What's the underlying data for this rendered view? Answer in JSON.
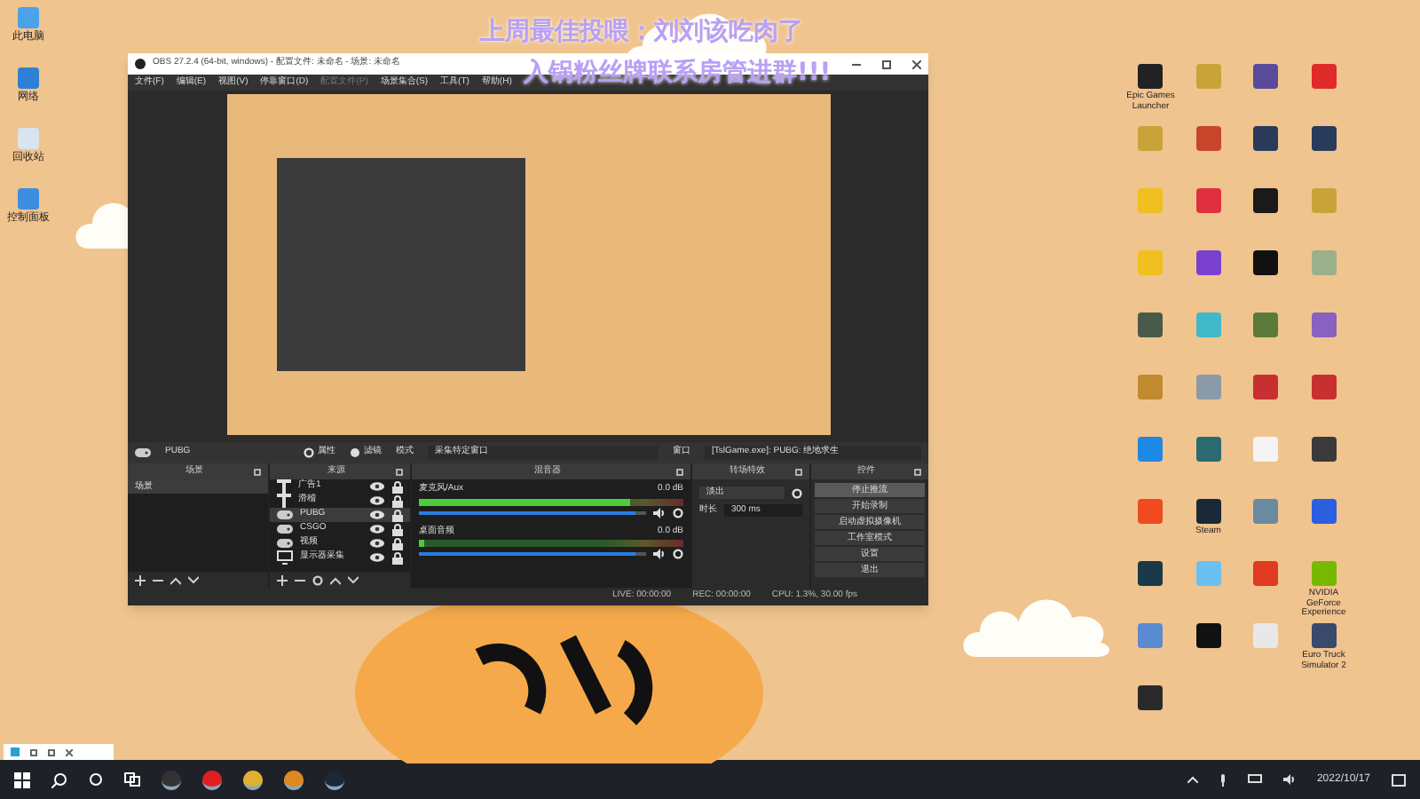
{
  "overlay": {
    "lines": [
      "上周最佳投喂：刘刘该吃肉了",
      "入锅粉丝牌联系房管进群!!!"
    ]
  },
  "left_icons": [
    {
      "label": "此电脑",
      "color": "#4aa3e8"
    },
    {
      "label": "网络",
      "color": "#2f7fd6"
    },
    {
      "label": "回收站",
      "color": "#d8e4ee"
    },
    {
      "label": "控制面板",
      "color": "#3d8ee0"
    }
  ],
  "right_icons": [
    {
      "label": "Epic Games Launcher",
      "color": "#222222"
    },
    {
      "color": "#c9a23a"
    },
    {
      "color": "#5a4a9a"
    },
    {
      "color": "#e02a2a"
    },
    {
      "color": "#c9a23a"
    },
    {
      "color": "#c8452c"
    },
    {
      "color": "#2a3a5a"
    },
    {
      "color": "#2a3a5a"
    },
    {
      "color": "#f0c020"
    },
    {
      "color": "#e03040"
    },
    {
      "color": "#1a1a1a"
    },
    {
      "color": "#c9a23a"
    },
    {
      "color": "#f0c020"
    },
    {
      "color": "#7a40d0"
    },
    {
      "color": "#111111"
    },
    {
      "color": "#9ab08a"
    },
    {
      "color": "#4a5a4a"
    },
    {
      "color": "#40b8c8"
    },
    {
      "color": "#5a7a3a"
    },
    {
      "color": "#8a60c0"
    },
    {
      "color": "#c08a30"
    },
    {
      "color": "#8a9aa8"
    },
    {
      "color": "#c83030"
    },
    {
      "color": "#c83030"
    },
    {
      "color": "#1e88e5"
    },
    {
      "color": "#2a6a70"
    },
    {
      "color": "#f4f4f4"
    },
    {
      "color": "#3a3a3a"
    },
    {
      "color": "#f04a20"
    },
    {
      "label": "Steam",
      "color": "#1b2838"
    },
    {
      "color": "#6a8aa0"
    },
    {
      "color": "#2a60e0"
    },
    {
      "color": "#1a3a4a"
    },
    {
      "color": "#6ac0f0"
    },
    {
      "color": "#e03a20"
    },
    {
      "label": "NVIDIA GeForce Experience",
      "color": "#76b900"
    },
    {
      "color": "#5a8ad0"
    },
    {
      "color": "#111111"
    },
    {
      "color": "#e8e8e8"
    },
    {
      "label": "Euro Truck Simulator 2",
      "color": "#3a4a6a"
    },
    {
      "color": "#2a2a2a"
    }
  ],
  "obs": {
    "title": "OBS 27.2.4 (64-bit, windows) - 配置文件: 未命名 - 场景: 未命名",
    "menu": [
      {
        "label": "文件(F)",
        "disabled": false
      },
      {
        "label": "编辑(E)",
        "disabled": false
      },
      {
        "label": "视图(V)",
        "disabled": false
      },
      {
        "label": "停靠窗口(D)",
        "disabled": false
      },
      {
        "label": "配置文件(P)",
        "disabled": true
      },
      {
        "label": "场景集合(S)",
        "disabled": false
      },
      {
        "label": "工具(T)",
        "disabled": false
      },
      {
        "label": "帮助(H)",
        "disabled": false
      }
    ],
    "source_toolbar": {
      "source": "PUBG",
      "properties": "属性",
      "filters": "滤镜",
      "mode_label": "模式",
      "mode_value": "采集特定窗口",
      "window_label": "窗口",
      "window_value": "[TslGame.exe]: PUBG: 绝地求生"
    },
    "scenes": {
      "title": "场景",
      "items": [
        {
          "label": "场景",
          "selected": true
        }
      ]
    },
    "sources": {
      "title": "来源",
      "items": [
        {
          "kind": "text",
          "label": "广告1",
          "selected": false
        },
        {
          "kind": "text",
          "label": "滑稽",
          "selected": false
        },
        {
          "kind": "game",
          "label": "PUBG",
          "selected": true
        },
        {
          "kind": "game",
          "label": "CSGO",
          "selected": false
        },
        {
          "kind": "game",
          "label": "视频",
          "selected": false
        },
        {
          "kind": "monitor",
          "label": "显示器采集",
          "selected": false
        }
      ]
    },
    "mixer": {
      "title": "混音器",
      "channels": [
        {
          "name": "麦克风/Aux",
          "reading": "0.0 dB",
          "meter": {
            "level": 0.8
          },
          "fader": {
            "level": 0.95
          }
        },
        {
          "name": "桌面音频",
          "reading": "0.0 dB",
          "meter": {
            "level": 0.02
          },
          "fader": {
            "level": 0.95
          }
        }
      ]
    },
    "transitions": {
      "title": "转场特效",
      "value": "淡出",
      "duration_label": "时长",
      "duration": "300 ms"
    },
    "controls": {
      "title": "控件",
      "buttons": [
        {
          "label": "停止推流",
          "selected": true
        },
        {
          "label": "开始录制",
          "selected": false
        },
        {
          "label": "启动虚拟摄像机",
          "selected": false
        },
        {
          "label": "工作室模式",
          "selected": false
        },
        {
          "label": "设置",
          "selected": false
        },
        {
          "label": "退出",
          "selected": false
        }
      ]
    },
    "status": {
      "live": "LIVE: 00:00:00",
      "rec": "REC: 00:00:00",
      "cpu": "CPU: 1.3%, 30.00 fps"
    }
  },
  "taskbar": {
    "date": "2022/10/17"
  }
}
